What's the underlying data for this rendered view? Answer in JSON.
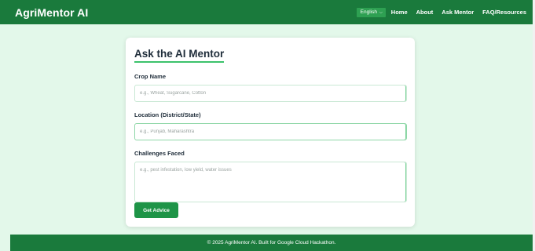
{
  "brand": "AgriMentor AI",
  "language": {
    "selected": "English"
  },
  "nav": [
    "Home",
    "About",
    "Ask Mentor",
    "FAQ/Resources"
  ],
  "form": {
    "title": "Ask the AI Mentor",
    "crop": {
      "label": "Crop Name",
      "placeholder": "e.g., Wheat, Sugarcane, Cotton",
      "value": ""
    },
    "location": {
      "label": "Location (District/State)",
      "placeholder": "e.g., Punjab, Maharashtra",
      "value": ""
    },
    "challenges": {
      "label": "Challenges Faced",
      "placeholder": "e.g., pest infestation, low yield, water issues",
      "value": ""
    },
    "submit_label": "Get Advice"
  },
  "footer": "© 2025 AgriMentor AI. Built for Google Cloud Hackathon.",
  "colors": {
    "header": "#1a7a3c",
    "background": "#e3f8ea",
    "accent": "#3cc26b",
    "button": "#1e9447"
  }
}
